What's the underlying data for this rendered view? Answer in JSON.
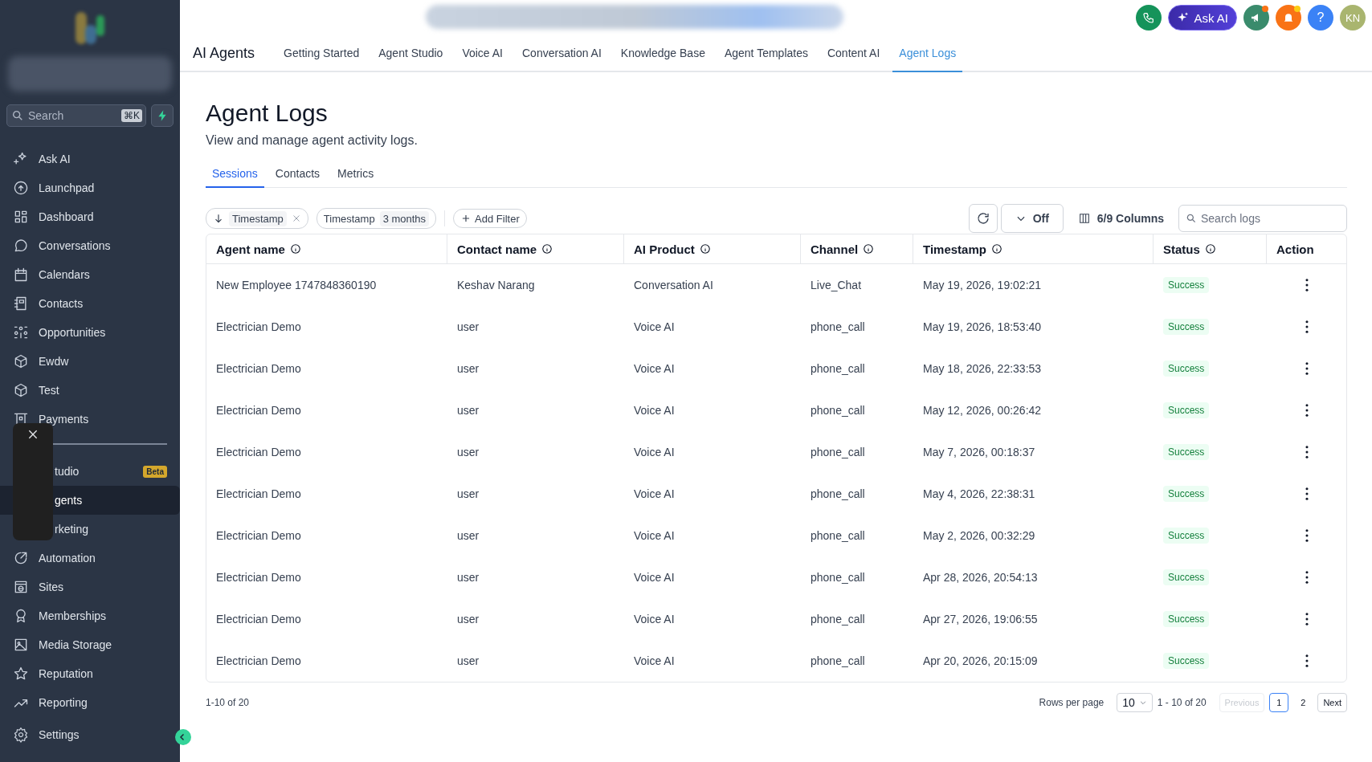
{
  "sidebar": {
    "search": {
      "placeholder": "Search",
      "shortcut": "⌘K"
    },
    "items": [
      {
        "label": "Ask AI",
        "selected": false
      },
      {
        "label": "Launchpad",
        "selected": false
      },
      {
        "label": "Dashboard",
        "selected": false
      },
      {
        "label": "Conversations",
        "selected": false
      },
      {
        "label": "Calendars",
        "selected": false
      },
      {
        "label": "Contacts",
        "selected": false
      },
      {
        "label": "Opportunities",
        "selected": false
      },
      {
        "label": "Ewdw",
        "selected": false
      },
      {
        "label": "Test",
        "selected": false
      },
      {
        "label": "Payments",
        "selected": false
      }
    ],
    "items_2": [
      {
        "label": "tudio",
        "selected": false,
        "badge": "Beta"
      },
      {
        "label": "gents",
        "selected": true
      },
      {
        "label": "rketing",
        "selected": false
      },
      {
        "label": "Automation",
        "selected": false
      },
      {
        "label": "Sites",
        "selected": false
      },
      {
        "label": "Memberships",
        "selected": false
      },
      {
        "label": "Media Storage",
        "selected": false
      },
      {
        "label": "Reputation",
        "selected": false
      },
      {
        "label": "Reporting",
        "selected": false
      }
    ],
    "settings": "Settings"
  },
  "top_bar": {
    "ask_ai": "Ask AI",
    "help": "?",
    "avatar": "KN"
  },
  "nav": {
    "title": "AI Agents",
    "tabs": [
      {
        "label": "Getting Started",
        "selected": false
      },
      {
        "label": "Agent Studio",
        "selected": false
      },
      {
        "label": "Voice AI",
        "selected": false
      },
      {
        "label": "Conversation AI",
        "selected": false
      },
      {
        "label": "Knowledge Base",
        "selected": false
      },
      {
        "label": "Agent Templates",
        "selected": false
      },
      {
        "label": "Content AI",
        "selected": false
      },
      {
        "label": "Agent Logs",
        "selected": true
      }
    ]
  },
  "page": {
    "title": "Agent Logs",
    "subtitle": "View and manage agent activity logs.",
    "tabs": [
      {
        "label": "Sessions",
        "selected": true
      },
      {
        "label": "Contacts",
        "selected": false
      },
      {
        "label": "Metrics",
        "selected": false
      }
    ]
  },
  "filters": {
    "sort_chip": "Timestamp",
    "range_chip": {
      "label": "Timestamp",
      "value": "3 months"
    },
    "add_filter": "Add Filter",
    "auto_refresh": "Off",
    "columns": "6/9 Columns",
    "search_placeholder": "Search logs"
  },
  "table": {
    "columns": [
      {
        "label": "Agent name",
        "info": true
      },
      {
        "label": "Contact name",
        "info": true
      },
      {
        "label": "AI Product",
        "info": true
      },
      {
        "label": "Channel",
        "info": true
      },
      {
        "label": "Timestamp",
        "info": true
      },
      {
        "label": "Status",
        "info": true
      },
      {
        "label": "Action",
        "info": false
      }
    ],
    "rows": [
      {
        "cells": [
          "New Employee 1747848360190",
          "Keshav Narang",
          "Conversation AI",
          "Live_Chat",
          "May 19, 2026, 19:02:21"
        ],
        "status": "Success"
      },
      {
        "cells": [
          "Electrician Demo",
          "user",
          "Voice AI",
          "phone_call",
          "May 19, 2026, 18:53:40"
        ],
        "status": "Success"
      },
      {
        "cells": [
          "Electrician Demo",
          "user",
          "Voice AI",
          "phone_call",
          "May 18, 2026, 22:33:53"
        ],
        "status": "Success"
      },
      {
        "cells": [
          "Electrician Demo",
          "user",
          "Voice AI",
          "phone_call",
          "May 12, 2026, 00:26:42"
        ],
        "status": "Success"
      },
      {
        "cells": [
          "Electrician Demo",
          "user",
          "Voice AI",
          "phone_call",
          "May 7, 2026, 00:18:37"
        ],
        "status": "Success"
      },
      {
        "cells": [
          "Electrician Demo",
          "user",
          "Voice AI",
          "phone_call",
          "May 4, 2026, 22:38:31"
        ],
        "status": "Success"
      },
      {
        "cells": [
          "Electrician Demo",
          "user",
          "Voice AI",
          "phone_call",
          "May 2, 2026, 00:32:29"
        ],
        "status": "Success"
      },
      {
        "cells": [
          "Electrician Demo",
          "user",
          "Voice AI",
          "phone_call",
          "Apr 28, 2026, 20:54:13"
        ],
        "status": "Success"
      },
      {
        "cells": [
          "Electrician Demo",
          "user",
          "Voice AI",
          "phone_call",
          "Apr 27, 2026, 19:06:55"
        ],
        "status": "Success"
      },
      {
        "cells": [
          "Electrician Demo",
          "user",
          "Voice AI",
          "phone_call",
          "Apr 20, 2026, 20:15:09"
        ],
        "status": "Success"
      }
    ]
  },
  "footer": {
    "range": "1-10 of 20",
    "rows_per_page_label": "Rows per page",
    "rows_per_page": "10",
    "page_range": "1 - 10 of 20",
    "previous": {
      "label": "Previous",
      "disabled": true
    },
    "pages": [
      {
        "label": "1",
        "selected": true
      },
      {
        "label": "2",
        "selected": false
      }
    ],
    "next": {
      "label": "Next",
      "disabled": false
    }
  }
}
